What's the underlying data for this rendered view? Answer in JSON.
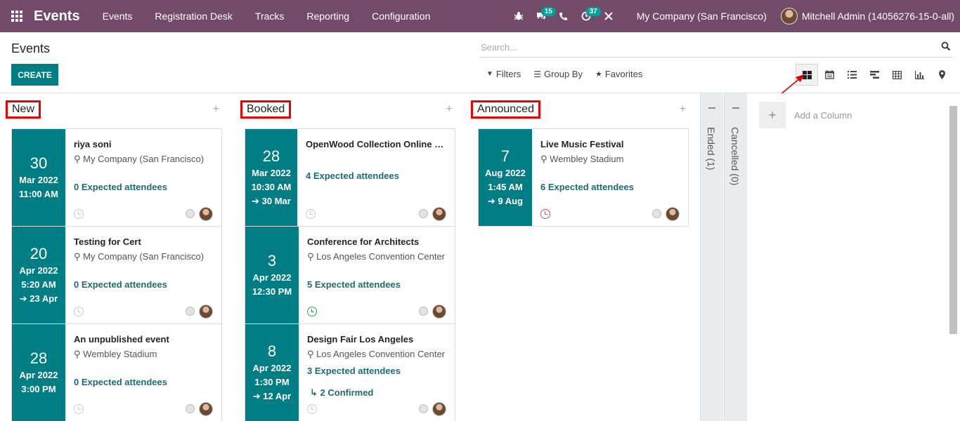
{
  "nav": {
    "brand": "Events",
    "menu": [
      "Events",
      "Registration Desk",
      "Tracks",
      "Reporting",
      "Configuration"
    ],
    "chat_badge": "15",
    "activity_badge": "37",
    "company": "My Company (San Francisco)",
    "user": "Mitchell Admin (14056276-15-0-all)"
  },
  "control": {
    "title": "Events",
    "create_label": "CREATE",
    "search_placeholder": "Search...",
    "filters_label": "Filters",
    "group_by_label": "Group By",
    "favorites_label": "Favorites"
  },
  "colors": {
    "navbar": "#714B67",
    "primary": "#017E84",
    "attendees": "#1e6b73",
    "annotation": "#e00000"
  },
  "columns": [
    {
      "title": "New",
      "cards": [
        {
          "day": "30",
          "month": "Mar 2022",
          "time": "11:00 AM",
          "end": "",
          "name": "riya soni",
          "location": "My Company (San Francisco)",
          "attendees": "0 Expected attendees",
          "confirmed": "",
          "clock": "grey"
        },
        {
          "day": "20",
          "month": "Apr 2022",
          "time": "5:20 AM",
          "end": "23 Apr",
          "name": "Testing for Cert",
          "location": "My Company (San Francisco)",
          "attendees": "0 Expected attendees",
          "confirmed": "",
          "clock": "grey"
        },
        {
          "day": "28",
          "month": "Apr 2022",
          "time": "3:00 PM",
          "end": "",
          "name": "An unpublished event",
          "location": "Wembley Stadium",
          "attendees": "0 Expected attendees",
          "confirmed": "",
          "clock": "grey"
        }
      ]
    },
    {
      "title": "Booked",
      "cards": [
        {
          "day": "28",
          "month": "Mar 2022",
          "time": "10:30 AM",
          "end": "30 Mar",
          "name": "OpenWood Collection Online Re...",
          "location": "",
          "attendees": "4 Expected attendees",
          "confirmed": "",
          "clock": "grey"
        },
        {
          "day": "3",
          "month": "Apr 2022",
          "time": "12:30 PM",
          "end": "",
          "name": "Conference for Architects",
          "location": "Los Angeles Convention Center",
          "attendees": "5 Expected attendees",
          "confirmed": "",
          "clock": "green"
        },
        {
          "day": "8",
          "month": "Apr 2022",
          "time": "1:30 PM",
          "end": "12 Apr",
          "name": "Design Fair Los Angeles",
          "location": "Los Angeles Convention Center",
          "attendees": "3 Expected attendees",
          "confirmed": "2 Confirmed",
          "clock": "grey"
        }
      ]
    },
    {
      "title": "Announced",
      "cards": [
        {
          "day": "7",
          "month": "Aug 2022",
          "time": "1:45 AM",
          "end": "9 Aug",
          "name": "Live Music Festival",
          "location": "Wembley Stadium",
          "attendees": "6 Expected attendees",
          "confirmed": "",
          "clock": "red"
        }
      ]
    }
  ],
  "folded": [
    "Ended (1)",
    "Cancelled (0)"
  ],
  "add_column_placeholder": "Add a Column"
}
